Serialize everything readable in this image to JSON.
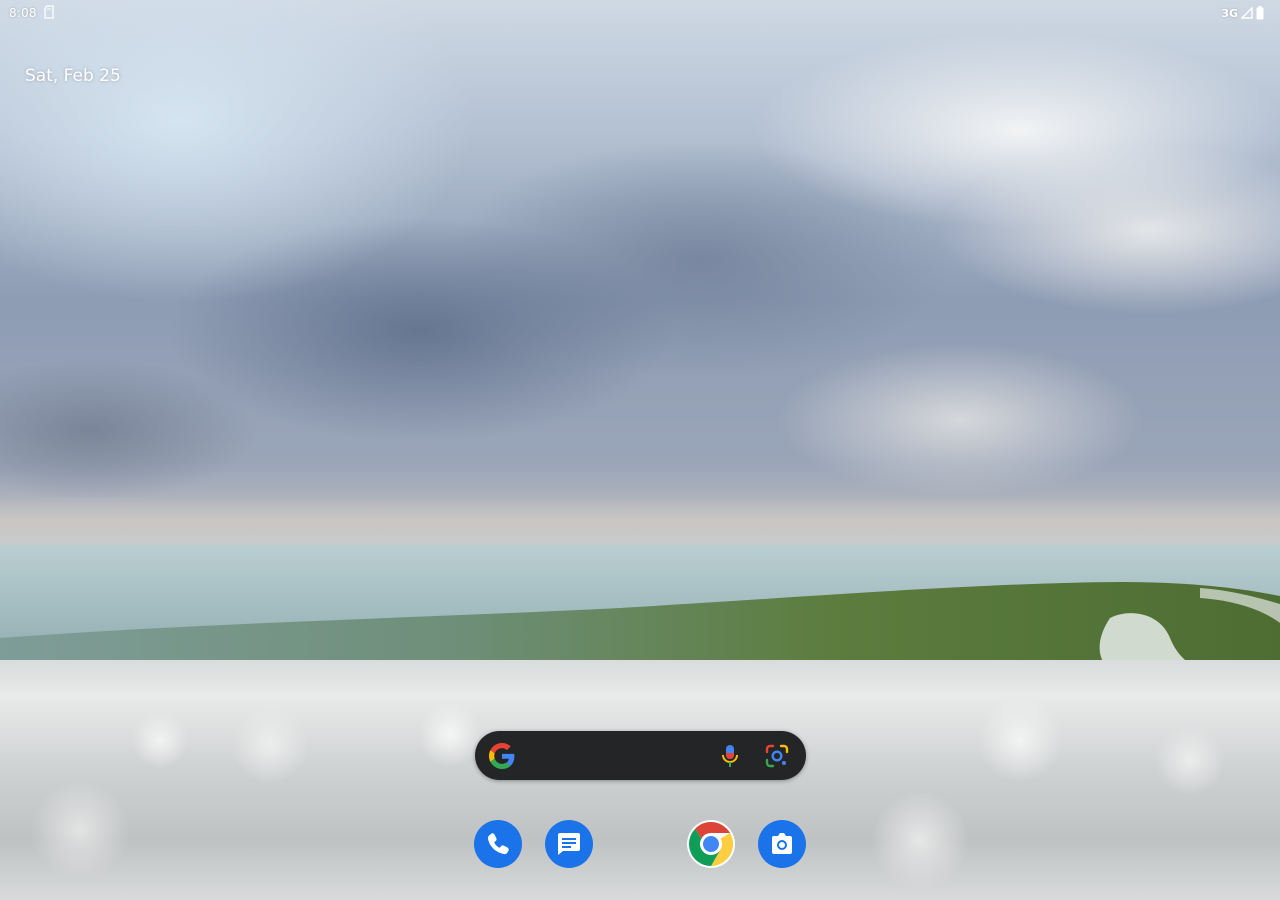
{
  "status_bar": {
    "time": "8:08",
    "notification_icon": "sd-card-icon",
    "network": "3G",
    "signal_icon": "cell-signal-icon",
    "battery_icon": "battery-icon"
  },
  "date_widget": {
    "text": "Sat, Feb 25"
  },
  "search_bar": {
    "logo_icon": "google-g-icon",
    "voice_icon": "mic-icon",
    "lens_icon": "google-lens-icon"
  },
  "dock": {
    "apps": [
      {
        "name": "Phone",
        "icon": "phone-icon",
        "color": "#1a73e8"
      },
      {
        "name": "Messages",
        "icon": "messages-icon",
        "color": "#1a73e8"
      },
      {
        "name": "Chrome",
        "icon": "chrome-icon",
        "color": "#db4437"
      },
      {
        "name": "Camera",
        "icon": "camera-icon",
        "color": "#1a73e8"
      }
    ]
  },
  "colors": {
    "search_bar_bg": "#242526",
    "google_blue": "#4285F4",
    "google_red": "#EA4335",
    "google_yellow": "#FBBC05",
    "google_green": "#34A853"
  }
}
